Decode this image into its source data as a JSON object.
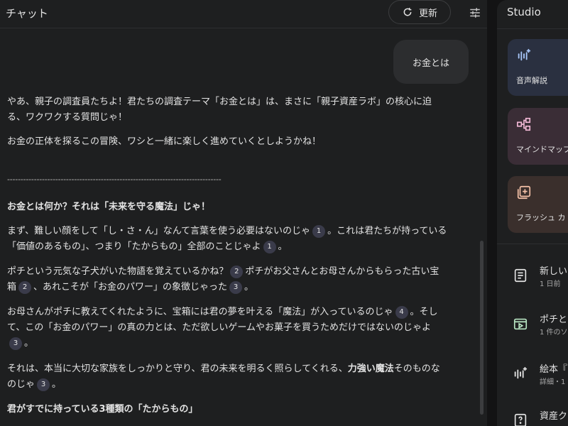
{
  "chat": {
    "title": "チャット",
    "refresh_label": "更新",
    "user_message": "お金とは",
    "p1": "やあ、親子の調査員たちよ！君たちの調査テーマ「お金とは」は、まさに「親子資産ラボ」の核心に迫る、ワクワクする質問じゃ！",
    "p2": "お金の正体を探るこの冒険、ワシと一緒に楽しく進めていくとしようかね！",
    "divider": "--------------------------------------------------------------------------------",
    "h1": "お金とは何か？それは「未来を守る魔法」じゃ！",
    "p3a": "まず、難しい顔をして「し・さ・ん」なんて言葉を使う必要はないのじゃ",
    "p3b": "。これは君たちが持っている「価値のあるもの」、つまり「たからもの」全部のことじゃよ",
    "p3c": "。",
    "p4a": "ポチという元気な子犬がいた物語を覚えているかね？",
    "p4b": "ポチがお父さんとお母さんからもらった古い宝箱",
    "p4c": "、あれこそが「お金のパワー」の象徴じゃった",
    "p4d": "。",
    "p5a": "お母さんがポチに教えてくれたように、宝箱には君の夢を叶える「魔法」が入っているのじゃ",
    "p5b": "。そして、この「お金のパワー」の真の力とは、ただ欲しいゲームやお菓子を買うためだけではないのじゃよ",
    "p5c": "。",
    "p6a": "それは、本当に大切な家族をしっかりと守り、君の未来を明るく照らしてくれる、",
    "p6b": "力強い魔法",
    "p6c": "そのものなのじゃ",
    "p6d": "。",
    "h2": "君がすでに持っている3種類の「たからもの」",
    "cites": {
      "c1": "1",
      "c2": "2",
      "c3": "3",
      "c4": "4"
    }
  },
  "studio": {
    "title": "Studio",
    "cards": [
      {
        "label": "音声解説",
        "icon": "audio-sparkle-icon"
      },
      {
        "label": "マインドマップ",
        "icon": "mindmap-icon"
      },
      {
        "label": "フラッシュ カ",
        "icon": "flashcard-icon"
      }
    ],
    "notes": [
      {
        "title": "新しい",
        "sub": "1 日前",
        "icon": "note-icon"
      },
      {
        "title": "ポチと",
        "sub": "1 件のソ",
        "icon": "video-icon"
      },
      {
        "title": "絵本『",
        "sub": "詳細・1",
        "icon": "audio-sparkle-icon"
      },
      {
        "title": "資産ク",
        "sub": "",
        "icon": "quiz-icon"
      }
    ]
  },
  "colors": {
    "background": "#1e1f20",
    "accent_citation": "#3a3b4a"
  }
}
